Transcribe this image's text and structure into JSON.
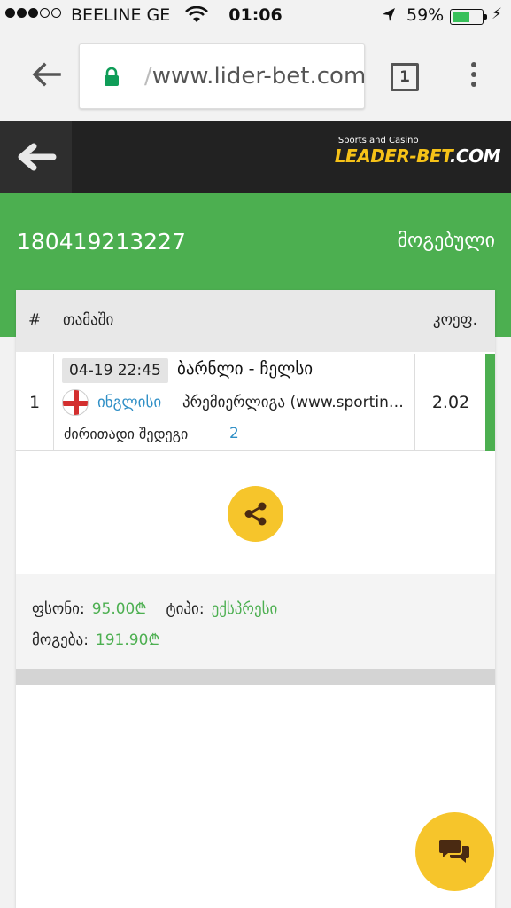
{
  "status_bar": {
    "carrier": "BEELINE GE",
    "time": "01:06",
    "battery": "59%",
    "battery_level": 0.59
  },
  "browser": {
    "url_prefix": "/",
    "url": "www.lider-bet.com",
    "tab_count": "1"
  },
  "site": {
    "logo_small": "Sports and Casino",
    "logo_main": "LEADER-BET",
    "logo_suffix": ".COM"
  },
  "ticket": {
    "id": "180419213227",
    "status": "მოგებული"
  },
  "table": {
    "headers": {
      "num": "#",
      "game": "თამაში",
      "odds": "კოეფ."
    },
    "rows": [
      {
        "num": "1",
        "datetime": "04-19 22:45",
        "match": "ბარნლი - ჩელსი",
        "country": "ინგლისი",
        "league": "პრემიერლიგა (www.sportingbet.com)",
        "market": "ძირითადი შედეგი",
        "pick": "2",
        "odds": "2.02"
      }
    ]
  },
  "summary": {
    "stake_label": "ფსონი:",
    "stake_value": "95.00₾",
    "type_label": "ტიპი:",
    "type_value": "ექსპრესი",
    "win_label": "მოგება:",
    "win_value": "191.90₾"
  },
  "colors": {
    "green": "#4caf50",
    "yellow": "#f6c52b",
    "dark": "#222222",
    "link_blue": "#2f8fc6"
  },
  "icons": [
    "back-arrow-icon",
    "lock-icon",
    "share-icon",
    "chat-icon",
    "menu-dots-icon",
    "flag-england-icon"
  ]
}
